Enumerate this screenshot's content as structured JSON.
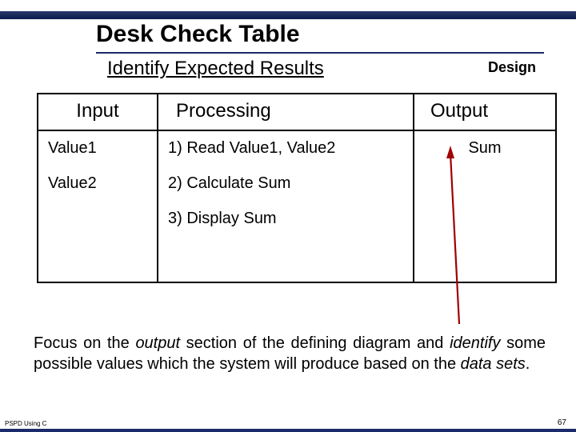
{
  "title": "Desk Check Table",
  "subtitle": "Identify Expected Results",
  "design_label": "Design",
  "table": {
    "headers": {
      "input": "Input",
      "processing": "Processing",
      "output": "Output"
    },
    "rows": [
      {
        "input": "Value1",
        "processing": "1) Read Value1, Value2",
        "output": "Sum"
      },
      {
        "input": "Value2",
        "processing": "2) Calculate Sum",
        "output": ""
      },
      {
        "input": "",
        "processing": "3) Display Sum",
        "output": ""
      },
      {
        "input": "",
        "processing": "",
        "output": ""
      }
    ]
  },
  "body": {
    "p1": "Focus on the ",
    "i1": "output",
    "p2": " section of the defining diagram and ",
    "i2": "identify",
    "p3": " some possible values which the system will produce based on the ",
    "i3": "data sets",
    "p4": "."
  },
  "footer": {
    "left": "PSPD Using C",
    "right": "67"
  }
}
